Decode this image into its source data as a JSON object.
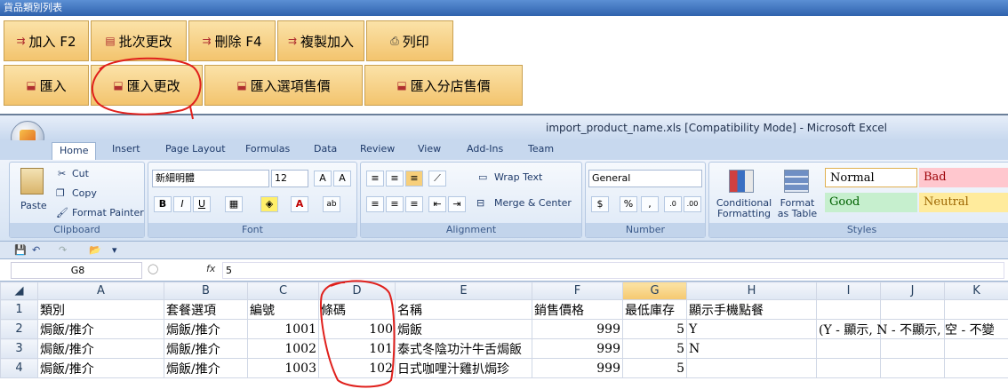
{
  "app": {
    "title": "貨品類別列表"
  },
  "toolbar1": [
    {
      "label": "加入 F2",
      "icon": "add-icon"
    },
    {
      "label": "批次更改",
      "icon": "batch-edit-icon"
    },
    {
      "label": "刪除 F4",
      "icon": "delete-icon"
    },
    {
      "label": "複製加入",
      "icon": "copy-add-icon"
    },
    {
      "label": "列印",
      "icon": "print-icon"
    }
  ],
  "toolbar2": [
    {
      "label": "匯入",
      "icon": "import-icon"
    },
    {
      "label": "匯入更改",
      "icon": "import-icon"
    },
    {
      "label": "匯入選項售價",
      "icon": "import-icon"
    },
    {
      "label": "匯入分店售價",
      "icon": "import-icon"
    }
  ],
  "excel": {
    "title": "import_product_name.xls  [Compatibility Mode] - Microsoft Excel",
    "tabs": [
      "Home",
      "Insert",
      "Page Layout",
      "Formulas",
      "Data",
      "Review",
      "View",
      "Add-Ins",
      "Team"
    ],
    "clipboard": {
      "paste": "Paste",
      "cut": "Cut",
      "copy": "Copy",
      "format_painter": "Format Painter",
      "group": "Clipboard"
    },
    "font": {
      "name": "新細明體",
      "size": "12",
      "group": "Font"
    },
    "alignment": {
      "wrap": "Wrap Text",
      "merge": "Merge & Center",
      "group": "Alignment"
    },
    "number": {
      "format": "General",
      "group": "Number"
    },
    "styles": {
      "conditional": "Conditional Formatting",
      "format_table": "Format as Table",
      "normal": "Normal",
      "bad": "Bad",
      "good": "Good",
      "neutral": "Neutral",
      "group": "Styles"
    },
    "name_box": "G8",
    "formula": "5",
    "columns": [
      "A",
      "B",
      "C",
      "D",
      "E",
      "F",
      "G",
      "H",
      "I",
      "J",
      "K"
    ],
    "rows": [
      {
        "num": "1",
        "cells": [
          "類別",
          "套餐選項",
          "編號",
          "條碼",
          "名稱",
          "銷售價格",
          "最低庫存",
          "顯示手機點餐",
          "",
          "",
          ""
        ]
      },
      {
        "num": "2",
        "cells": [
          "焗飯/推介",
          "焗飯/推介",
          "1001",
          "100",
          "焗飯",
          "999",
          "5",
          "Y",
          "(Y - 顯示, N - 不顯示, 空 - 不變",
          "",
          ""
        ]
      },
      {
        "num": "3",
        "cells": [
          "焗飯/推介",
          "焗飯/推介",
          "1002",
          "101",
          "泰式冬陰功汁牛舌焗飯",
          "999",
          "5",
          "N",
          "",
          "",
          ""
        ]
      },
      {
        "num": "4",
        "cells": [
          "焗飯/推介",
          "焗飯/推介",
          "1003",
          "102",
          "日式咖哩汁雞扒焗珍",
          "999",
          "5",
          "",
          "",
          "",
          ""
        ]
      }
    ]
  },
  "colors": {
    "button": "#f7d48c",
    "annotation": "#e0201c",
    "selected_col": "#f5c86f"
  }
}
